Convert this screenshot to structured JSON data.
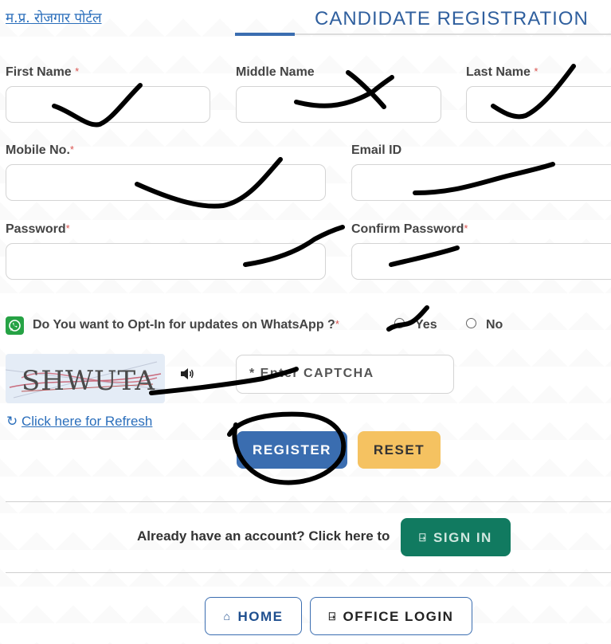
{
  "header": {
    "portal_link": "म.प्र. रोजगार पोर्टल",
    "title": "CANDIDATE REGISTRATION"
  },
  "form": {
    "first_name_label": "First Name",
    "middle_name_label": "Middle Name",
    "last_name_label": "Last Name",
    "mobile_label": "Mobile No.",
    "email_label": "Email ID",
    "password_label": "Password",
    "confirm_password_label": "Confirm Password",
    "required_mark": "*",
    "first_name_value": "",
    "middle_name_value": "",
    "last_name_value": "",
    "mobile_value": "",
    "email_value": "",
    "password_value": "",
    "confirm_password_value": ""
  },
  "whatsapp": {
    "question": "Do You want to Opt-In for updates on WhatsApp ?",
    "options": [
      "Yes",
      "No"
    ]
  },
  "captcha": {
    "image_text": "SHWUTA",
    "placeholder": "* Enter CAPTCHA",
    "refresh_link": "Click here for Refresh"
  },
  "buttons": {
    "register": "REGISTER",
    "reset": "RESET",
    "sign_in": "SIGN IN",
    "home": "HOME",
    "office_login": "OFFICE LOGIN"
  },
  "signin_prompt": "Already have an account? Click here to",
  "colors": {
    "primary": "#3a6db0",
    "reset": "#f5c261",
    "signin": "#117a60",
    "required": "#d9534f",
    "link": "#2a6ebb"
  }
}
